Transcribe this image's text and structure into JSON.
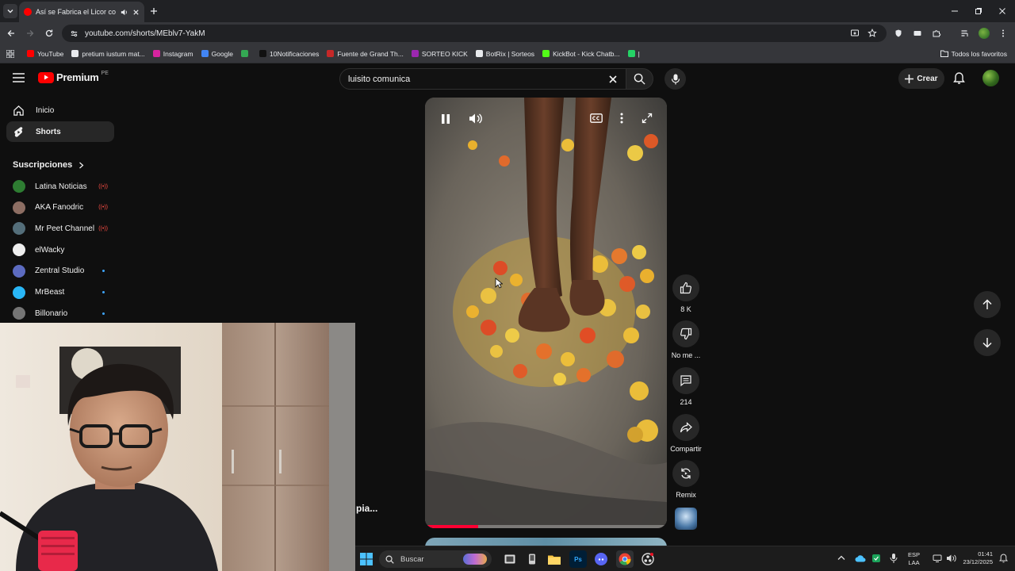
{
  "browser": {
    "tab_title": "Así se Fabrica el Licor con s",
    "url": "youtube.com/shorts/MEblv7-YakM",
    "bookmarks": [
      {
        "label": "YouTube",
        "color": "#ff0000"
      },
      {
        "label": "pretium iustum mat...",
        "color": "#e8eaed"
      },
      {
        "label": "Instagram",
        "color": "#d6249f"
      },
      {
        "label": "Google",
        "color": "#4285f4"
      },
      {
        "label": "",
        "color": "#34a853"
      },
      {
        "label": "10Notificaciones",
        "color": "#111111"
      },
      {
        "label": "Fuente de Grand Th...",
        "color": "#c62828"
      },
      {
        "label": "SORTEO KICK",
        "color": "#9c27b0"
      },
      {
        "label": "BotRix | Sorteos",
        "color": "#e8eaed"
      },
      {
        "label": "KickBot - Kick Chatb...",
        "color": "#53fc18"
      },
      {
        "label": "|",
        "color": "#25d366"
      }
    ],
    "all_bookmarks_label": "Todos los favoritos"
  },
  "youtube": {
    "logo_text": "Premium",
    "logo_region": "PE",
    "search_query": "luisito comunica",
    "create_label": "Crear"
  },
  "sidebar": {
    "home_label": "Inicio",
    "shorts_label": "Shorts",
    "subscriptions_label": "Suscripciones",
    "subscriptions": [
      {
        "name": "Latina Noticias",
        "color": "#2e7d32",
        "status": "live"
      },
      {
        "name": "AKA Fanodric",
        "color": "#8d6e63",
        "status": "live"
      },
      {
        "name": "Mr Peet Channel",
        "color": "#546e7a",
        "status": "live"
      },
      {
        "name": "elWacky",
        "color": "#eeeeee",
        "status": ""
      },
      {
        "name": "Zentral Studio",
        "color": "#5c6bc0",
        "status": "new"
      },
      {
        "name": "MrBeast",
        "color": "#29b6f6",
        "status": "new"
      },
      {
        "name": "Billonario",
        "color": "#757575",
        "status": "new"
      }
    ]
  },
  "short": {
    "likes": "8 K",
    "dislike_label": "No me ...",
    "comments": "214",
    "share_label": "Compartir",
    "remix_label": "Remix",
    "caption_fragment": "pia...",
    "progress": 0.22
  },
  "taskbar": {
    "search_placeholder": "Buscar",
    "lang": "ESP",
    "lang_sub": "LAA",
    "time": "01:41",
    "date": "23/12/2025"
  }
}
